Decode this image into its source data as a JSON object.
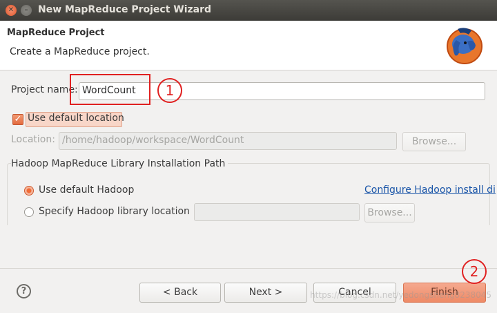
{
  "window": {
    "title": "New MapReduce Project Wizard"
  },
  "header": {
    "title": "MapReduce Project",
    "description": "Create a MapReduce project."
  },
  "form": {
    "project_name_label": "Project name:",
    "project_name_value": "WordCount",
    "use_default_location_label": "Use default location",
    "use_default_location_checked": true,
    "location_label": "Location:",
    "location_value": "/home/hadoop/workspace/WordCount",
    "location_browse_label": "Browse..."
  },
  "hadoop_group": {
    "title": "Hadoop MapReduce Library Installation Path",
    "use_default_label": "Use default Hadoop",
    "configure_link": "Configure Hadoop install di",
    "specify_label": "Specify Hadoop library location",
    "specify_browse_label": "Browse...",
    "selected": "use_default"
  },
  "footer": {
    "help_symbol": "?",
    "back_label": "< Back",
    "next_label": "Next >",
    "cancel_label": "Cancel",
    "finish_label": "Finish"
  },
  "annotations": {
    "marker_1": "1",
    "marker_2": "2"
  },
  "watermark": "https://blog.csdn.net/yedongsheng8238045",
  "colors": {
    "accent": "#e46a3f",
    "annotation": "#e02020",
    "link": "#1a55a8"
  }
}
